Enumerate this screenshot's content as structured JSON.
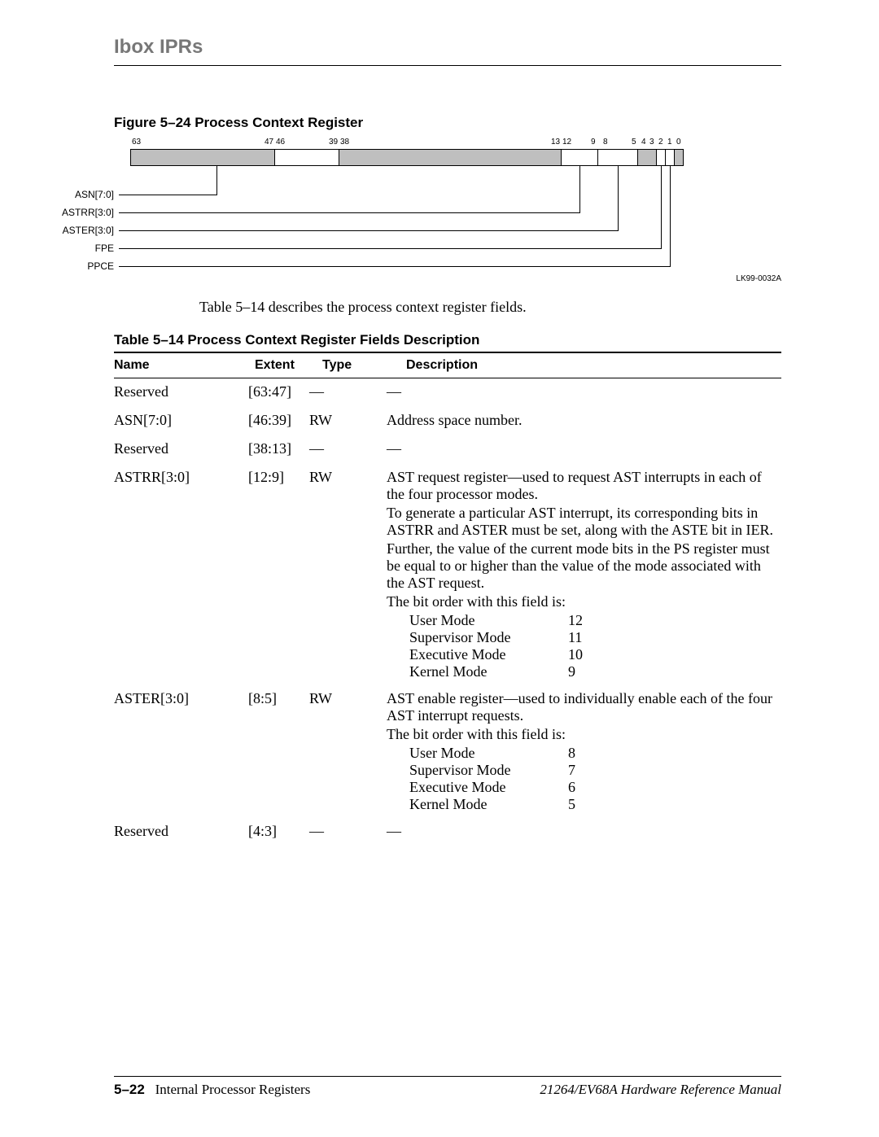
{
  "header": {
    "title": "Ibox IPRs"
  },
  "figure": {
    "caption": "Figure 5–24  Process Context Register",
    "bit_numbers": [
      "63",
      "47",
      "46",
      "39",
      "38",
      "13",
      "12",
      "9",
      "8",
      "5",
      "4",
      "3",
      "2",
      "1",
      "0"
    ],
    "labels": [
      "ASN[7:0]",
      "ASTRR[3:0]",
      "ASTER[3:0]",
      "FPE",
      "PPCE"
    ],
    "id": "LK99-0032A"
  },
  "intro": "Table 5–14 describes the process context register fields.",
  "table": {
    "caption": "Table 5–14  Process Context Register Fields Description",
    "headers": [
      "Name",
      "Extent",
      "Type",
      "Description"
    ],
    "rows": [
      {
        "name": "Reserved",
        "extent": "[63:47]",
        "type": "—",
        "desc_lines": [
          "—"
        ]
      },
      {
        "name": "ASN[7:0]",
        "extent": "[46:39]",
        "type": "RW",
        "desc_lines": [
          "Address space number."
        ]
      },
      {
        "name": "Reserved",
        "extent": "[38:13]",
        "type": "—",
        "desc_lines": [
          "—"
        ]
      },
      {
        "name": "ASTRR[3:0]",
        "extent": "[12:9]",
        "type": "RW",
        "desc_lines": [
          "AST request register—used to request AST interrupts in each of the four processor modes.",
          "To generate a particular AST interrupt, its corresponding bits in ASTRR and ASTER must be set, along with the ASTE bit in IER.",
          "Further, the value of the current mode bits in the PS register must be equal to or higher than the value of the mode associated with the AST request.",
          "The bit order with this field is:"
        ],
        "modes": [
          {
            "mode": "User Mode",
            "bit": "12"
          },
          {
            "mode": "Supervisor Mode",
            "bit": "11"
          },
          {
            "mode": "Executive Mode",
            "bit": "10"
          },
          {
            "mode": "Kernel Mode",
            "bit": "9"
          }
        ]
      },
      {
        "name": "ASTER[3:0]",
        "extent": "[8:5]",
        "type": "RW",
        "desc_lines": [
          "AST enable register—used to individually enable each of the four AST interrupt requests.",
          "The bit order with this field is:"
        ],
        "modes": [
          {
            "mode": "User Mode",
            "bit": "8"
          },
          {
            "mode": "Supervisor Mode",
            "bit": "7"
          },
          {
            "mode": "Executive Mode",
            "bit": "6"
          },
          {
            "mode": "Kernel Mode",
            "bit": "5"
          }
        ]
      },
      {
        "name": "Reserved",
        "extent": "[4:3]",
        "type": "—",
        "desc_lines": [
          "—"
        ]
      }
    ]
  },
  "footer": {
    "page": "5–22",
    "section": "Internal Processor Registers",
    "manual": "21264/EV68A Hardware Reference Manual"
  }
}
